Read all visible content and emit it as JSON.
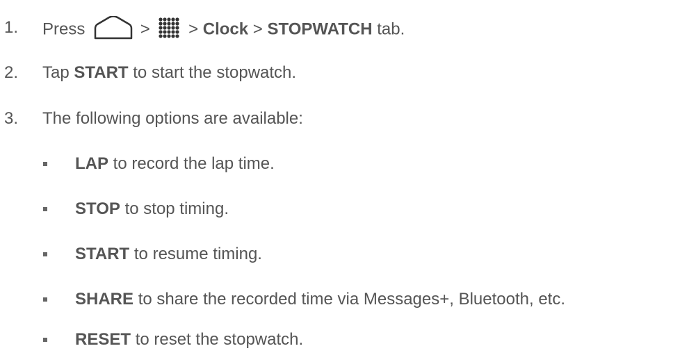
{
  "steps": [
    {
      "number": "1.",
      "parts": [
        "Press",
        ">",
        ">",
        "Clock",
        ">",
        "STOPWATCH",
        "tab."
      ],
      "icons": [
        "home-icon",
        "apps-icon"
      ]
    },
    {
      "number": "2.",
      "parts": [
        "Tap",
        "START",
        "to start the stopwatch."
      ]
    },
    {
      "number": "3.",
      "parts": [
        "The following options are available:"
      ]
    }
  ],
  "options": [
    {
      "label": "LAP",
      "text": "to record the lap time."
    },
    {
      "label": "STOP",
      "text": "to stop timing."
    },
    {
      "label": "START",
      "text": "to resume timing."
    },
    {
      "label": "SHARE",
      "text": "to share the recorded time via Messages+, Bluetooth, etc."
    },
    {
      "label": "RESET",
      "text": "to reset the stopwatch."
    }
  ],
  "colors": {
    "text": "#555555",
    "bullet": "#666666",
    "icon": "#333333"
  }
}
